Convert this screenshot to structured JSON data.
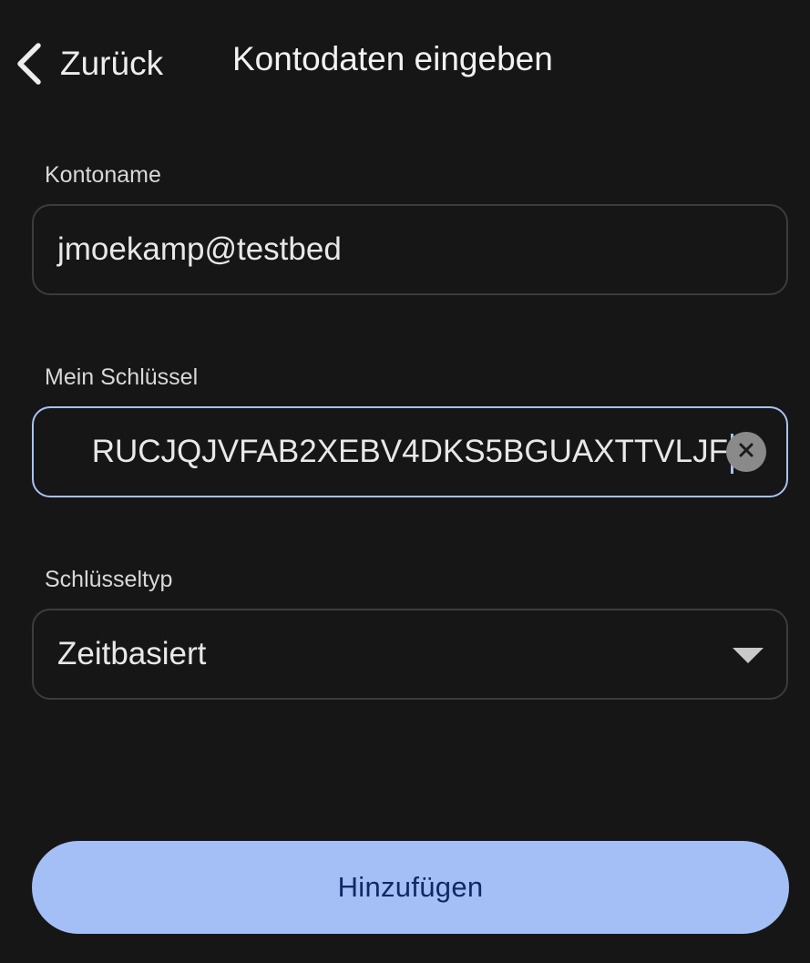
{
  "header": {
    "back_label": "Zurück",
    "title": "Kontodaten eingeben"
  },
  "form": {
    "account_name": {
      "label": "Kontoname",
      "value": "jmoekamp@testbed"
    },
    "secret_key": {
      "label": "Mein Schlüssel",
      "value": "RUCJQJVFAB2XEBV4DKS5BGUAXTTVLJF",
      "focused": true
    },
    "key_type": {
      "label": "Schlüsseltyp",
      "selected": "Zeitbasiert"
    }
  },
  "actions": {
    "submit_label": "Hinzufügen"
  },
  "icons": {
    "back": "chevron-left-icon",
    "clear": "clear-circle-icon",
    "dropdown": "caret-down-icon"
  },
  "colors": {
    "background": "#161616",
    "accent": "#a3bff5",
    "focus_border": "#a9c2f2",
    "button_text": "#0f2a66"
  }
}
